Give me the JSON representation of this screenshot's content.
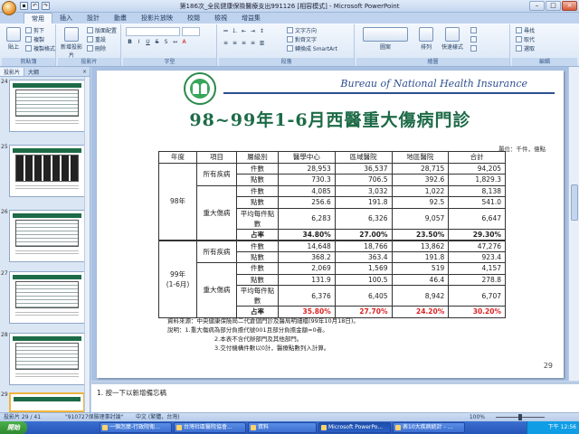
{
  "window": {
    "title": "第186次_全民健康保險醫療支出991126 [相容模式] - Microsoft PowerPoint"
  },
  "ribbon": {
    "tabs": [
      "常用",
      "插入",
      "設計",
      "動畫",
      "投影片放映",
      "校閱",
      "檢視",
      "增益集"
    ],
    "paste_label": "貼上",
    "cut_label": "剪下",
    "copy_label": "複製",
    "format_painter_label": "複製格式",
    "new_slide_label": "新增投影片",
    "layout_label": "版面配置",
    "reset_label": "重設",
    "delete_label": "刪除",
    "font_size_placeholder": "",
    "text_direction_label": "文字方向",
    "align_text_label": "對齊文字",
    "smartart_label": "轉換成 SmartArt",
    "shapes_label": "圖案",
    "arrange_label": "排列",
    "quick_styles_label": "快速樣式",
    "find_label": "尋找",
    "replace_label": "取代",
    "select_label": "選取",
    "groups": [
      "剪貼簿",
      "投影片",
      "字型",
      "段落",
      "繪圖",
      "編輯"
    ]
  },
  "left_panel": {
    "tabs": [
      "投影片",
      "大綱"
    ],
    "close": "×",
    "slide_numbers": [
      "24",
      "25",
      "26",
      "27",
      "28",
      "29"
    ]
  },
  "slide": {
    "org_name": "Bureau of National Health Insurance",
    "title": "98~99年1-6月西醫重大傷病門診",
    "units": "單位：千件，億點",
    "headers": [
      "年度",
      "項目",
      "層級別",
      "醫學中心",
      "區域醫院",
      "地區醫院",
      "合計"
    ],
    "groups": [
      {
        "year": "98年",
        "blocks": [
          {
            "item": "所有疾病",
            "rows": [
              {
                "label": "件數",
                "values": [
                  "28,953",
                  "36,537",
                  "28,715",
                  "94,205"
                ]
              },
              {
                "label": "點數",
                "values": [
                  "730.3",
                  "706.5",
                  "392.6",
                  "1,829.3"
                ]
              }
            ]
          },
          {
            "item": "重大傷病",
            "rows": [
              {
                "label": "件數",
                "values": [
                  "4,085",
                  "3,032",
                  "1,022",
                  "8,138"
                ]
              },
              {
                "label": "點數",
                "values": [
                  "256.6",
                  "191.8",
                  "92.5",
                  "541.0"
                ]
              },
              {
                "label": "平均每件點數",
                "values": [
                  "6,283",
                  "6,326",
                  "9,057",
                  "6,647"
                ]
              },
              {
                "label": "占率",
                "values": [
                  "34.80%",
                  "27.00%",
                  "23.50%",
                  "29.30%"
                ]
              }
            ]
          }
        ]
      },
      {
        "year": "99年",
        "year_sub": "(1-6月)",
        "blocks": [
          {
            "item": "所有疾病",
            "rows": [
              {
                "label": "件數",
                "values": [
                  "14,648",
                  "18,766",
                  "13,862",
                  "47,276"
                ]
              },
              {
                "label": "點數",
                "values": [
                  "368.2",
                  "363.4",
                  "191.8",
                  "923.4"
                ]
              }
            ]
          },
          {
            "item": "重大傷病",
            "rows": [
              {
                "label": "件數",
                "values": [
                  "2,069",
                  "1,569",
                  "519",
                  "4,157"
                ]
              },
              {
                "label": "點數",
                "values": [
                  "131.9",
                  "100.5",
                  "46.4",
                  "278.8"
                ]
              },
              {
                "label": "平均每件點數",
                "values": [
                  "6,376",
                  "6,405",
                  "8,942",
                  "6,707"
                ]
              },
              {
                "label": "占率",
                "values": [
                  "35.80%",
                  "27.70%",
                  "24.20%",
                  "30.20%"
                ]
              }
            ]
          }
        ]
      }
    ],
    "notes": [
      "資料來源：中央健康保險局二代倉儲門診及醫局明細檔(99年10月18日)。",
      "說明：1.重大傷病為部分負擔代號001且部分負擔金額=0者。",
      "2.本表不含代辦部門及其他部門。",
      "3.交付機構件數以0計，醫療點數列入計算。"
    ],
    "page_number": "29"
  },
  "notes_pane": {
    "text": "1.  按一下以新增備忘稿"
  },
  "status": {
    "slide_info": "投影片 29 / 41",
    "theme": "\"910727保險理事討論\"",
    "language": "中文 (繁體，台灣)",
    "zoom": "100%"
  },
  "taskbar": {
    "start_label": "開始",
    "tasks": [
      "一個怎麼-行政院衛...",
      "台灣社區醫院協會...",
      "資料",
      "Microsoft PowerPo...",
      "表10大疾病統計 - ..."
    ],
    "clock": "下午 12:56"
  }
}
